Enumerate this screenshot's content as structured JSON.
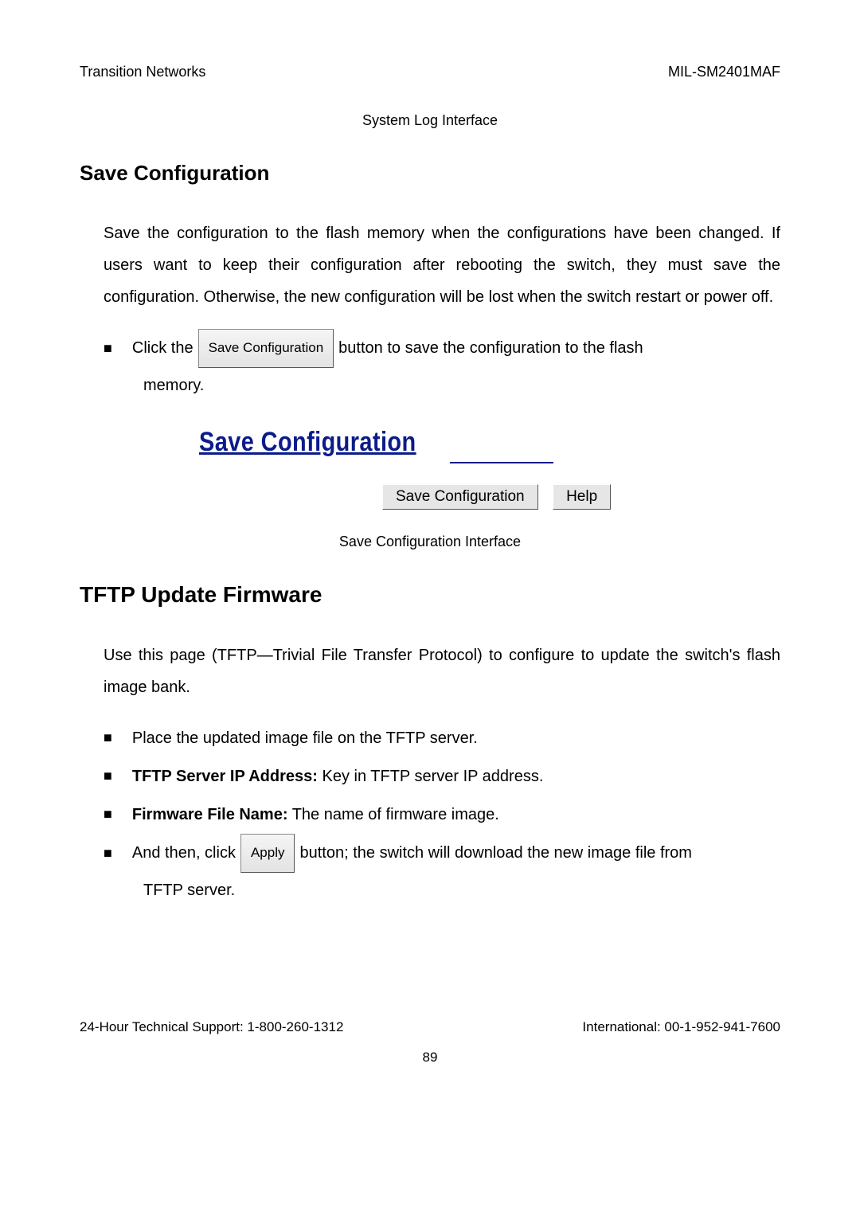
{
  "header": {
    "left": "Transition Networks",
    "right": "MIL-SM2401MAF"
  },
  "caption_top": "System Log Interface",
  "section1": {
    "heading": "Save Configuration",
    "para": "Save the configuration to the flash memory when the configurations have been changed. If users want to keep their configuration after rebooting the switch, they must save the configuration. Otherwise, the new configuration will be lost when the switch restart or power off.",
    "bullet_prefix": "Click the",
    "button_label": "Save Configuration",
    "bullet_suffix": "button to save the configuration to the flash",
    "bullet_continue": "memory."
  },
  "screenshot": {
    "title": "Save Configuration",
    "btn_save": "Save Configuration",
    "btn_help": "Help"
  },
  "caption_mid": "Save Configuration Interface",
  "section2": {
    "heading": "TFTP Update Firmware",
    "para": "Use this page (TFTP—Trivial File Transfer Protocol) to configure to update the switch's flash image bank.",
    "items": [
      {
        "plain": "Place the updated image file on the TFTP server."
      },
      {
        "bold": "TFTP Server IP Address:",
        "rest": " Key in TFTP server IP address."
      },
      {
        "bold": "Firmware File Name:",
        "rest": " The name of firmware image."
      }
    ],
    "last_prefix": "And then, click",
    "apply_label": "Apply",
    "last_suffix": "button; the switch will download the new image file from",
    "last_continue": "TFTP server."
  },
  "footer": {
    "left": "24-Hour Technical Support: 1-800-260-1312",
    "right": "International: 00-1-952-941-7600",
    "page": "89"
  }
}
